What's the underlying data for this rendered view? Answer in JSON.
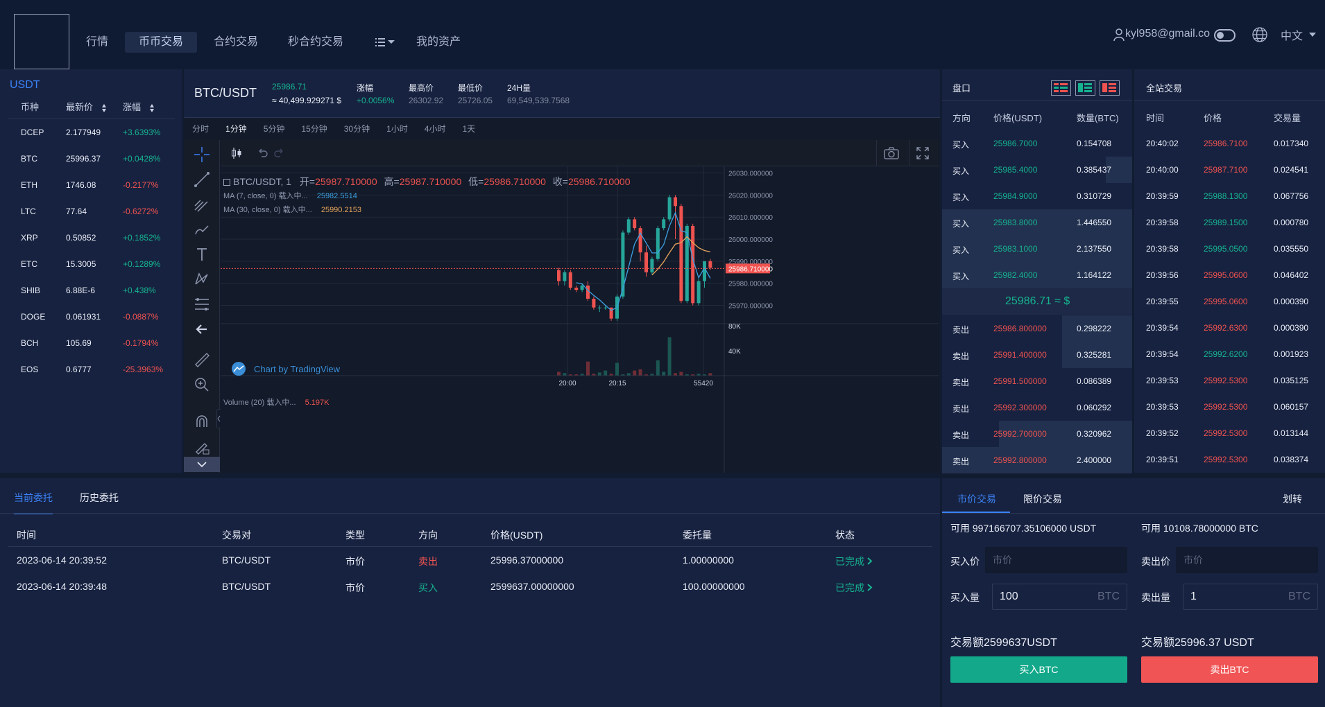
{
  "nav": {
    "items": [
      "行情",
      "币币交易",
      "合约交易",
      "秒合约交易",
      "我的资产"
    ],
    "user": "kyl958@gmail.co",
    "lang": "中文"
  },
  "market": {
    "title": "USDT",
    "headers": [
      "币种",
      "最新价",
      "涨幅"
    ],
    "rows": [
      {
        "coin": "DCEP",
        "price": "2.177949",
        "change": "+3.6393%",
        "dir": "up"
      },
      {
        "coin": "BTC",
        "price": "25996.37",
        "change": "+0.0428%",
        "dir": "up"
      },
      {
        "coin": "ETH",
        "price": "1746.08",
        "change": "-0.2177%",
        "dir": "down"
      },
      {
        "coin": "LTC",
        "price": "77.64",
        "change": "-0.6272%",
        "dir": "down"
      },
      {
        "coin": "XRP",
        "price": "0.50852",
        "change": "+0.1852%",
        "dir": "up"
      },
      {
        "coin": "ETC",
        "price": "15.3005",
        "change": "+0.1289%",
        "dir": "up"
      },
      {
        "coin": "SHIB",
        "price": "6.88E-6",
        "change": "+0.438%",
        "dir": "up"
      },
      {
        "coin": "DOGE",
        "price": "0.061931",
        "change": "-0.0887%",
        "dir": "down"
      },
      {
        "coin": "BCH",
        "price": "105.69",
        "change": "-0.1794%",
        "dir": "down"
      },
      {
        "coin": "EOS",
        "price": "0.6777",
        "change": "-25.3963%",
        "dir": "down"
      }
    ]
  },
  "ticker": {
    "pair": "BTC/USDT",
    "last": "25986.71",
    "usd": "≈ 40,499.929271 $",
    "change_label": "涨幅",
    "change": "+0.0056%",
    "high_label": "最高价",
    "high": "26302.92",
    "low_label": "最低价",
    "low": "25726.05",
    "vol_label": "24H量",
    "vol": "69,549,539.7568"
  },
  "timeframes": [
    "分时",
    "1分钟",
    "5分钟",
    "15分钟",
    "30分钟",
    "1小时",
    "4小时",
    "1天"
  ],
  "chart": {
    "legend_pair": "BTC/USDT, 1",
    "legend_open_label": "开=",
    "legend_open": "25987.710000",
    "legend_high_label": "高=",
    "legend_high": "25987.710000",
    "legend_low_label": "低=",
    "legend_low": "25986.710000",
    "legend_close_label": "收=",
    "legend_close": "25986.710000",
    "ma7_label": "MA (7, close, 0) 载入中...",
    "ma7_value": "25982.5514",
    "ma30_label": "MA (30, close, 0) 载入中...",
    "ma30_value": "25990.2153",
    "vol_label": "Volume (20) 载入中...",
    "vol_value": "5.197K",
    "watermark": "Chart by TradingView",
    "price_ticks": [
      "26030.000000",
      "26020.000000",
      "26010.000000",
      "26000.000000",
      "25990.000000",
      "25980.000000",
      "25970.000000"
    ],
    "current_price": "25986.710000",
    "vol_ticks": [
      "80K",
      "40K"
    ],
    "time_ticks": [
      "20:00",
      "20:15",
      "55420"
    ],
    "colors": {
      "up": "#26a69a",
      "down": "#ef5350"
    }
  },
  "chart_data": {
    "type": "candlestick",
    "title": "BTC/USDT, 1",
    "ylim": [
      25962,
      26033
    ],
    "candles": [
      {
        "o": 25986,
        "h": 25987,
        "l": 25979,
        "c": 25981
      },
      {
        "o": 25981,
        "h": 25986,
        "l": 25979,
        "c": 25985
      },
      {
        "o": 25985,
        "h": 25986,
        "l": 25977,
        "c": 25978
      },
      {
        "o": 25978,
        "h": 25979,
        "l": 25976,
        "c": 25977
      },
      {
        "o": 25977,
        "h": 25980,
        "l": 25976,
        "c": 25979
      },
      {
        "o": 25979,
        "h": 25981,
        "l": 25972,
        "c": 25973
      },
      {
        "o": 25973,
        "h": 25974,
        "l": 25968,
        "c": 25969
      },
      {
        "o": 25969,
        "h": 25970,
        "l": 25967,
        "c": 25969
      },
      {
        "o": 25969,
        "h": 25970,
        "l": 25968,
        "c": 25969
      },
      {
        "o": 25969,
        "h": 25969,
        "l": 25963,
        "c": 25964
      },
      {
        "o": 25964,
        "h": 25975,
        "l": 25963,
        "c": 25974
      },
      {
        "o": 25974,
        "h": 26004,
        "l": 25973,
        "c": 26003
      },
      {
        "o": 26003,
        "h": 26010,
        "l": 26002,
        "c": 26009
      },
      {
        "o": 26009,
        "h": 26010,
        "l": 26004,
        "c": 26005
      },
      {
        "o": 26005,
        "h": 26006,
        "l": 25990,
        "c": 25994
      },
      {
        "o": 25994,
        "h": 25997,
        "l": 25983,
        "c": 25985
      },
      {
        "o": 25985,
        "h": 25992,
        "l": 25984,
        "c": 25991
      },
      {
        "o": 25991,
        "h": 26006,
        "l": 25990,
        "c": 26005
      },
      {
        "o": 26005,
        "h": 26010,
        "l": 26004,
        "c": 26009
      },
      {
        "o": 26009,
        "h": 26020,
        "l": 26008,
        "c": 26019
      },
      {
        "o": 26019,
        "h": 26020,
        "l": 26000,
        "c": 26015
      },
      {
        "o": 26015,
        "h": 26016,
        "l": 25971,
        "c": 25972
      },
      {
        "o": 25972,
        "h": 26007,
        "l": 25971,
        "c": 26006
      },
      {
        "o": 26006,
        "h": 26007,
        "l": 25970,
        "c": 25971
      },
      {
        "o": 25971,
        "h": 25982,
        "l": 25970,
        "c": 25981
      },
      {
        "o": 25981,
        "h": 25990,
        "l": 25978,
        "c": 25990
      },
      {
        "o": 25990,
        "h": 25991,
        "l": 25986,
        "c": 25987
      }
    ],
    "volume": [
      6,
      4,
      2,
      2,
      3,
      22,
      3,
      5,
      8,
      3,
      20,
      2,
      4,
      8,
      10,
      2,
      3,
      24,
      6,
      60,
      4,
      6,
      2,
      2,
      3,
      2,
      4
    ]
  },
  "book": {
    "title": "盘口",
    "headers": [
      "方向",
      "价格(USDT)",
      "数量(BTC)"
    ],
    "buys": [
      {
        "side": "买入",
        "price": "25986.7000",
        "qty": "0.154708",
        "depth": 0
      },
      {
        "side": "买入",
        "price": "25985.4000",
        "qty": "0.385437",
        "depth": 14
      },
      {
        "side": "买入",
        "price": "25984.9000",
        "qty": "0.310729",
        "depth": 0
      },
      {
        "side": "买入",
        "price": "25983.8000",
        "qty": "1.446550",
        "depth": 100
      },
      {
        "side": "买入",
        "price": "25983.1000",
        "qty": "2.137550",
        "depth": 100
      },
      {
        "side": "买入",
        "price": "25982.4000",
        "qty": "1.164122",
        "depth": 100
      }
    ],
    "mid": "25986.71 ≈ $",
    "sells": [
      {
        "side": "卖出",
        "price": "25986.800000",
        "qty": "0.298222",
        "depth": 37
      },
      {
        "side": "卖出",
        "price": "25991.400000",
        "qty": "0.325281",
        "depth": 37
      },
      {
        "side": "卖出",
        "price": "25991.500000",
        "qty": "0.086389",
        "depth": 0
      },
      {
        "side": "卖出",
        "price": "25992.300000",
        "qty": "0.060292",
        "depth": 0
      },
      {
        "side": "卖出",
        "price": "25992.700000",
        "qty": "0.320962",
        "depth": 70
      },
      {
        "side": "卖出",
        "price": "25992.800000",
        "qty": "2.400000",
        "depth": 100
      }
    ]
  },
  "trades": {
    "title": "全站交易",
    "headers": [
      "时间",
      "价格",
      "交易量"
    ],
    "rows": [
      {
        "time": "20:40:02",
        "price": "25986.7100",
        "qty": "0.017340",
        "dir": "down"
      },
      {
        "time": "20:40:00",
        "price": "25987.7100",
        "qty": "0.024541",
        "dir": "down"
      },
      {
        "time": "20:39:59",
        "price": "25988.1300",
        "qty": "0.067756",
        "dir": "up"
      },
      {
        "time": "20:39:58",
        "price": "25989.1500",
        "qty": "0.000780",
        "dir": "up"
      },
      {
        "time": "20:39:58",
        "price": "25995.0500",
        "qty": "0.035550",
        "dir": "up"
      },
      {
        "time": "20:39:56",
        "price": "25995.0600",
        "qty": "0.046402",
        "dir": "down"
      },
      {
        "time": "20:39:55",
        "price": "25995.0600",
        "qty": "0.000390",
        "dir": "down"
      },
      {
        "time": "20:39:54",
        "price": "25992.6300",
        "qty": "0.000390",
        "dir": "down"
      },
      {
        "time": "20:39:54",
        "price": "25992.6200",
        "qty": "0.001923",
        "dir": "up"
      },
      {
        "time": "20:39:53",
        "price": "25992.5300",
        "qty": "0.035125",
        "dir": "down"
      },
      {
        "time": "20:39:53",
        "price": "25992.5300",
        "qty": "0.060157",
        "dir": "down"
      },
      {
        "time": "20:39:52",
        "price": "25992.5300",
        "qty": "0.013144",
        "dir": "down"
      },
      {
        "time": "20:39:51",
        "price": "25992.5300",
        "qty": "0.038374",
        "dir": "down"
      }
    ]
  },
  "orders": {
    "tabs": [
      "当前委托",
      "历史委托"
    ],
    "headers": [
      "时间",
      "交易对",
      "类型",
      "方向",
      "价格(USDT)",
      "委托量",
      "状态"
    ],
    "rows": [
      {
        "time": "2023-06-14 20:39:52",
        "pair": "BTC/USDT",
        "type": "市价",
        "side": "卖出",
        "dir": "down",
        "price": "25996.37000000",
        "qty": "1.00000000",
        "status": "已完成"
      },
      {
        "time": "2023-06-14 20:39:48",
        "pair": "BTC/USDT",
        "type": "市价",
        "side": "买入",
        "dir": "up",
        "price": "2599637.00000000",
        "qty": "100.00000000",
        "status": "已完成"
      }
    ]
  },
  "form": {
    "tabs": [
      "市价交易",
      "限价交易"
    ],
    "transfer": "划转",
    "buy_avail": "可用 997166707.35106000 USDT",
    "sell_avail": "可用 10108.78000000 BTC",
    "buy_price_label": "买入价",
    "buy_price_placeholder": "市价",
    "sell_price_label": "卖出价",
    "sell_price_placeholder": "市价",
    "buy_qty_label": "买入量",
    "buy_qty": "100",
    "sell_qty_label": "卖出量",
    "sell_qty": "1",
    "unit": "BTC",
    "buy_total": "交易额2599637USDT",
    "sell_total": "交易额25996.37 USDT",
    "buy_button": "买入BTC",
    "sell_button": "卖出BTC",
    "colors": {
      "buy": "#13a88a",
      "sell": "#f05454"
    }
  }
}
